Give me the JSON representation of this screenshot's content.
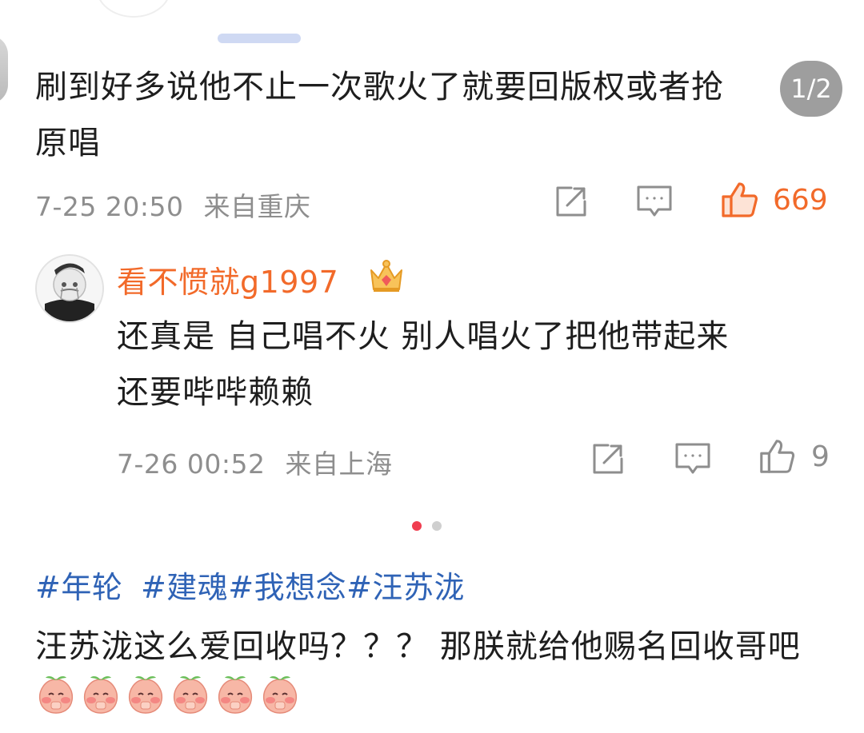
{
  "page_indicator": "1/2",
  "comment1": {
    "text_line1": "刷到好多说他不止一次歌火了就要回版权或者抢",
    "text_line2": "原唱",
    "timestamp": "7-25 20:50",
    "location": "来自重庆",
    "likes": "669"
  },
  "comment2": {
    "username": "看不惯就g1997",
    "text_line1": "还真是 自己唱不火 别人唱火了把他带起来",
    "text_line2": "还要哔哔赖赖",
    "timestamp": "7-26 00:52",
    "location": "来自上海",
    "likes": "9"
  },
  "post": {
    "hashtags": [
      "#年轮",
      "#建魂",
      "#我想念",
      "#汪苏泷"
    ],
    "text": "汪苏泷这么爱回收吗？？？ 那朕就给他赐名回收哥吧"
  },
  "colors": {
    "accent_orange": "#f26a2a",
    "hashtag_blue": "#2f63b6",
    "carousel_active": "#f03e50",
    "meta_gray": "#8e8e8e"
  },
  "icons": [
    "share-icon",
    "comment-icon",
    "like-icon",
    "crown-badge-icon",
    "peach-emoji-icon"
  ]
}
